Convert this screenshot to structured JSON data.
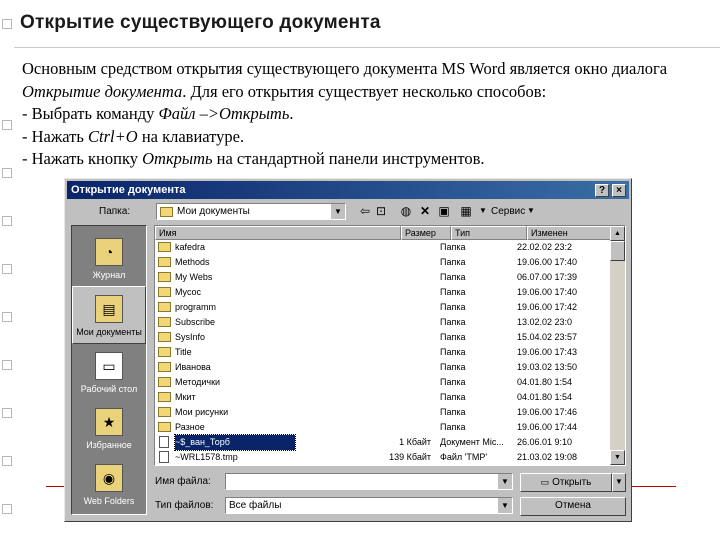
{
  "slide": {
    "title": "Открытие существующего документа",
    "para1_a": "Основным средством открытия существующего документа MS Word является окно диалога ",
    "para1_b": "Открытие документа",
    "para1_c": ". Для его открытия существует несколько способов:",
    "line2_a": "- Выбрать команду ",
    "line2_b": "Файл –>Открыть",
    "line2_c": ".",
    "line3_a": "- Нажать ",
    "line3_b": "Ctrl+O",
    "line3_c": " на клавиатуре.",
    "line4_a": "- Нажать кнопку ",
    "line4_b": "Открыть",
    "line4_c": " на стандартной панели инструментов."
  },
  "dialog": {
    "title": "Открытие документа",
    "help_btn": "?",
    "close_btn": "×",
    "folder_label": "Папка:",
    "folder_value": "Мои документы",
    "service_label": "Сервис",
    "places": [
      {
        "label": "Журнал",
        "icon": "history-icon"
      },
      {
        "label": "Мои документы",
        "icon": "my-documents-icon"
      },
      {
        "label": "Рабочий стол",
        "icon": "desktop-icon"
      },
      {
        "label": "Избранное",
        "icon": "favorites-icon"
      },
      {
        "label": "Web Folders",
        "icon": "web-folders-icon"
      }
    ],
    "columns": {
      "name": "Имя",
      "size": "Размер",
      "type": "Тип",
      "date": "Изменен"
    },
    "files": [
      {
        "name": "kafedra",
        "size": "",
        "type": "Папка",
        "date": "22.02.02 23:2"
      },
      {
        "name": "Methods",
        "size": "",
        "type": "Папка",
        "date": "19.06.00 17:40"
      },
      {
        "name": "My Webs",
        "size": "",
        "type": "Папка",
        "date": "06.07.00 17:39"
      },
      {
        "name": "Mycoc",
        "size": "",
        "type": "Папка",
        "date": "19.06.00 17:40"
      },
      {
        "name": "programm",
        "size": "",
        "type": "Папка",
        "date": "19.06.00 17:42"
      },
      {
        "name": "Subscribe",
        "size": "",
        "type": "Папка",
        "date": "13.02.02 23:0"
      },
      {
        "name": "SysInfo",
        "size": "",
        "type": "Папка",
        "date": "15.04.02 23:57"
      },
      {
        "name": "Title",
        "size": "",
        "type": "Папка",
        "date": "19.06.00 17:43"
      },
      {
        "name": "Иванова",
        "size": "",
        "type": "Папка",
        "date": "19.03.02 13:50"
      },
      {
        "name": "Методички",
        "size": "",
        "type": "Папка",
        "date": "04.01.80 1:54"
      },
      {
        "name": "Мкит",
        "size": "",
        "type": "Папка",
        "date": "04.01.80 1:54"
      },
      {
        "name": "Мои рисунки",
        "size": "",
        "type": "Папка",
        "date": "19.06.00 17:46"
      },
      {
        "name": "Разное",
        "size": "",
        "type": "Папка",
        "date": "19.06.00 17:44"
      },
      {
        "name": "~$_ван_Торб",
        "size": "1 Кбайт",
        "type": "Документ Mic...",
        "date": "26.06.01 9:10"
      },
      {
        "name": "~WRL1578.tmp",
        "size": "139 Кбайт",
        "type": "Файл 'TMP'",
        "date": "21.03.02 19:08"
      }
    ],
    "filename_label": "Имя файла:",
    "filename_value": "",
    "filetype_label": "Тип файлов:",
    "filetype_value": "Все файлы",
    "open_button": "Открыть",
    "cancel_button": "Отмена"
  }
}
